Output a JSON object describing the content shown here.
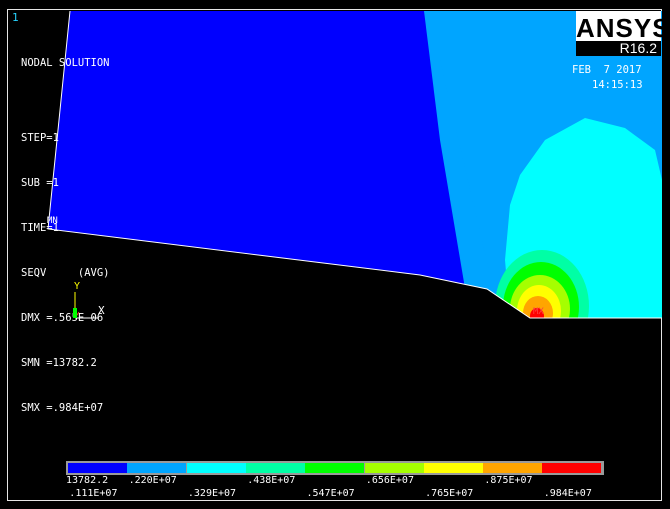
{
  "window": {
    "number": "1"
  },
  "plot_info": {
    "lines": [
      "NODAL SOLUTION",
      "",
      "STEP=1",
      "SUB =1",
      "TIME=1",
      "SEQV     (AVG)",
      "DMX =.565E-06",
      "SMN =13782.2",
      "SMX =.984E+07"
    ]
  },
  "logo": {
    "brand": "ANSYS",
    "version": "R16.2"
  },
  "timestamp": {
    "date": "FEB  7 2017",
    "time": "14:15:13"
  },
  "markers": {
    "min": "MN",
    "max": "MX"
  },
  "triad": {
    "y": "Y",
    "x": "X"
  },
  "legend": {
    "colors": [
      "#0000ff",
      "#00a5ff",
      "#00ffff",
      "#00ffa5",
      "#00ff00",
      "#a5ff00",
      "#ffff00",
      "#ffa500",
      "#ff0000"
    ],
    "labels": [
      ".111E+07",
      ".220E+07",
      ".329E+07",
      ".438E+07",
      ".547E+07",
      ".656E+07",
      ".765E+07",
      ".875E+07",
      ".984E+07"
    ],
    "label_positions": [
      "bottom",
      "top",
      "bottom",
      "top",
      "bottom",
      "top",
      "bottom",
      "top",
      "bottom"
    ],
    "min_label": "13782.2"
  }
}
